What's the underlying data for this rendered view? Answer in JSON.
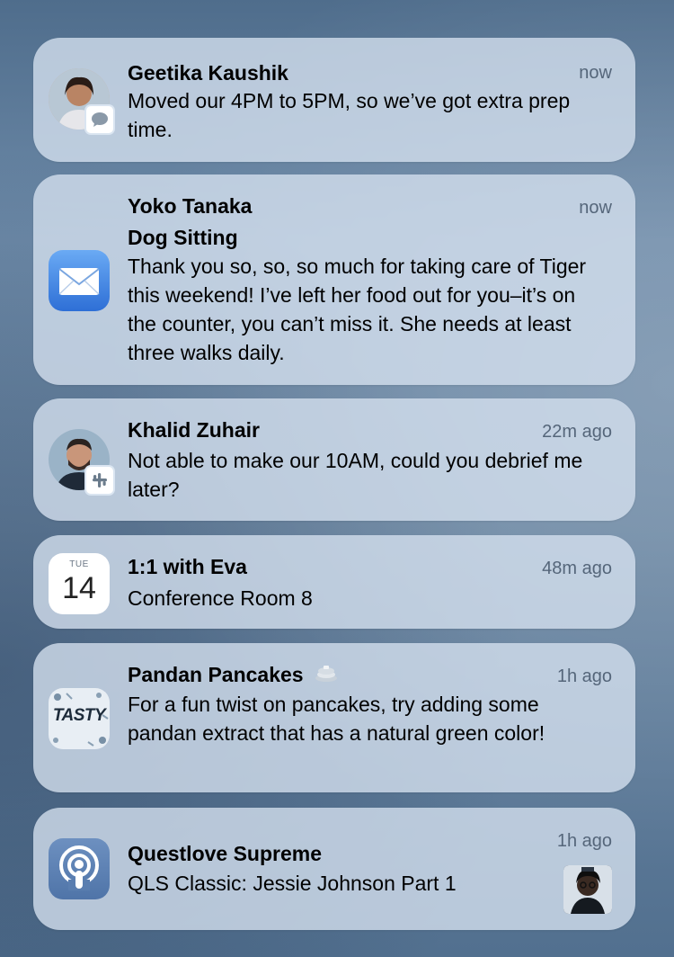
{
  "notifications": [
    {
      "app": "Messages",
      "icon": "contact-avatar-geetika",
      "badge_icon": "messages-badge-icon",
      "sender": "Geetika Kaushik",
      "time": "now",
      "message": "Moved our 4PM to 5PM, so we’ve got extra prep time."
    },
    {
      "app": "Mail",
      "icon": "mail-icon",
      "sender": "Yoko Tanaka",
      "subject": "Dog Sitting",
      "time": "now",
      "message": "Thank you so, so, so much for taking care of Tiger this weekend! I’ve left her food out for you–it’s on the counter, you can’t miss it. She needs at least three walks daily."
    },
    {
      "app": "Slack",
      "icon": "contact-avatar-khalid",
      "badge_icon": "slack-badge-icon",
      "sender": "Khalid Zuhair",
      "time": "22m ago",
      "message": "Not able to make our 10AM, could you debrief me later?"
    },
    {
      "app": "Calendar",
      "icon": "calendar-icon",
      "calendar_day": "TUE",
      "calendar_date": "14",
      "sender": "1:1 with Eva",
      "time": "48m ago",
      "message": "Conference Room 8"
    },
    {
      "app": "Tasty",
      "icon": "tasty-app-icon",
      "icon_text": "TASTY",
      "sender": "Pandan Pancakes",
      "time": "1h ago",
      "message": "For a fun twist on pancakes, try adding some pandan extract that has a natural green color!"
    },
    {
      "app": "Podcasts",
      "icon": "podcasts-icon",
      "sender": "Questlove Supreme",
      "time": "1h ago",
      "message": "QLS Classic: Jessie Johnson Part 1"
    }
  ],
  "colors": {
    "card_bg": "#d6e2f0",
    "time_text": "#55667a",
    "podcasts_purple": "#8e4ce0",
    "mail_blue": "#3b82e8",
    "slack_badge_bg": "#ffffff"
  }
}
